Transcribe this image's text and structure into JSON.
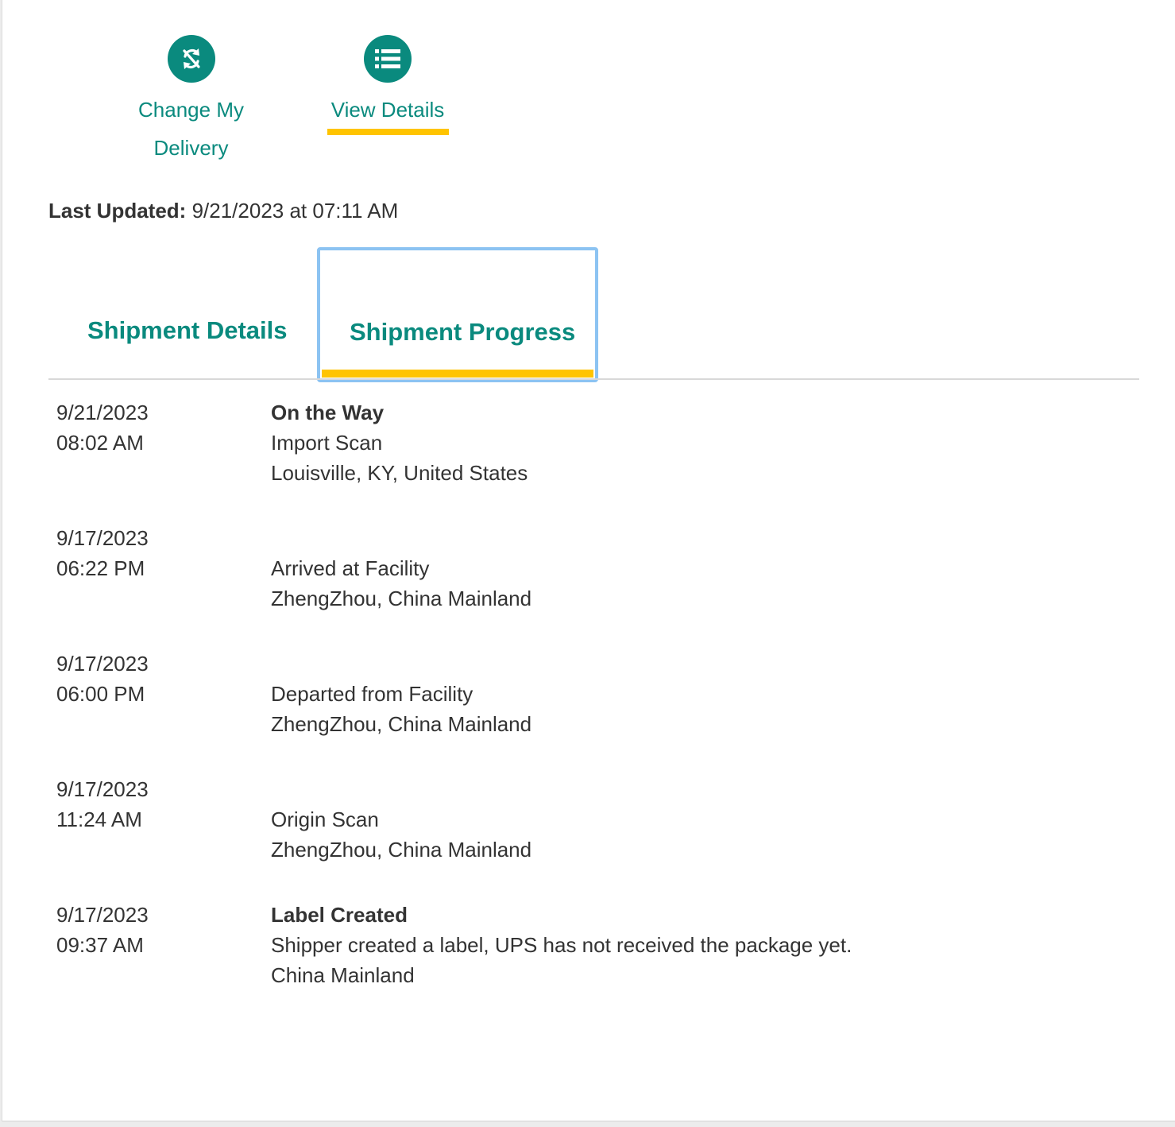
{
  "actions": {
    "change_delivery": {
      "label_line1": "Change My",
      "label_line2": "Delivery",
      "icon": "refresh-arrows-icon"
    },
    "view_details": {
      "label": "View Details",
      "icon": "list-icon"
    }
  },
  "last_updated": {
    "label": "Last Updated:",
    "value": "9/21/2023 at 07:11 AM"
  },
  "tabs": {
    "shipment_details": "Shipment Details",
    "shipment_progress": "Shipment Progress"
  },
  "events": [
    {
      "date": "9/21/2023",
      "time": "08:02 AM",
      "status": "On the Way",
      "activity": "Import Scan",
      "location": "Louisville, KY, United States"
    },
    {
      "date": "9/17/2023",
      "time": "06:22 PM",
      "status": "",
      "activity": "Arrived at Facility",
      "location": "ZhengZhou, China Mainland"
    },
    {
      "date": "9/17/2023",
      "time": "06:00 PM",
      "status": "",
      "activity": "Departed from Facility",
      "location": "ZhengZhou, China Mainland"
    },
    {
      "date": "9/17/2023",
      "time": "11:24 AM",
      "status": "",
      "activity": "Origin Scan",
      "location": "ZhengZhou, China Mainland"
    },
    {
      "date": "9/17/2023",
      "time": "09:37 AM",
      "status": "Label Created",
      "activity": "Shipper created a label, UPS has not received the package yet.",
      "location": "China Mainland"
    }
  ],
  "colors": {
    "accent": "#0a8a7e",
    "highlight": "#ffc400",
    "focus": "#8cc3f2"
  }
}
